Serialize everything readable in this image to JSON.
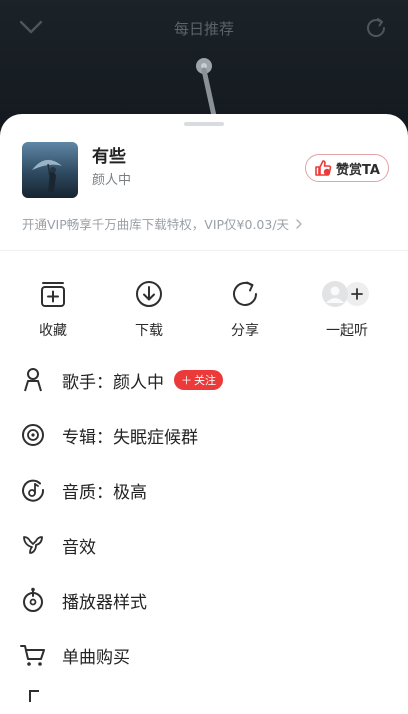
{
  "background": {
    "title": "每日推荐",
    "icons": [
      "chevron-down-icon",
      "share-icon"
    ]
  },
  "song": {
    "title": "有些",
    "artist": "颜人中",
    "tip_label": "赞赏TA",
    "vip_promo": "开通VIP畅享千万曲库下载特权，VIP仅¥0.03/天"
  },
  "actions": [
    {
      "label": "收藏",
      "icon": "add-collection-icon"
    },
    {
      "label": "下载",
      "icon": "download-icon"
    },
    {
      "label": "分享",
      "icon": "share-icon"
    },
    {
      "label": "一起听",
      "icon": "listen-together-icon"
    }
  ],
  "menu": {
    "singer": "歌手：颜人中",
    "follow_label": "关注",
    "album": "专辑：失眠症候群",
    "quality": "音质：极高",
    "effects": "音效",
    "player_style": "播放器样式",
    "purchase": "单曲购买"
  },
  "colors": {
    "accent_red": "#ec3a3a",
    "sheet_bg": "#ffffff",
    "backdrop": "#13191f"
  }
}
